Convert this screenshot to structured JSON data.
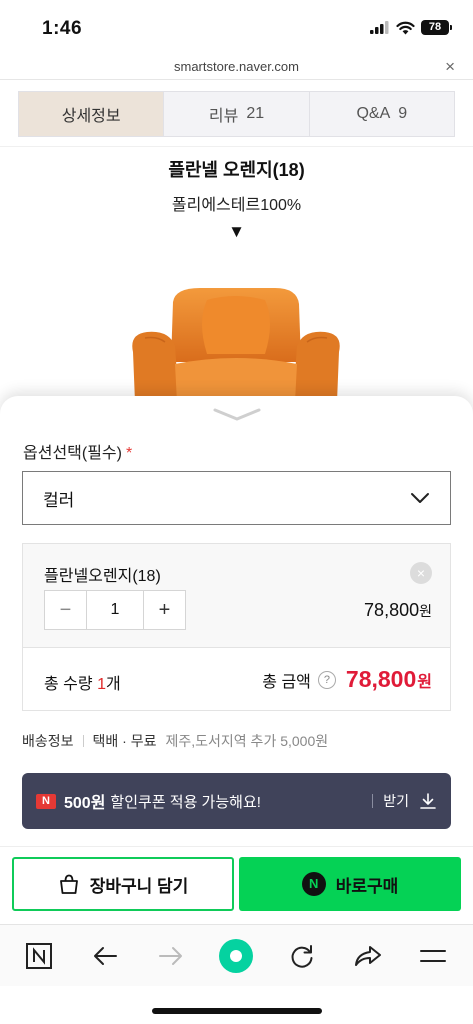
{
  "status_bar": {
    "time": "1:46",
    "battery": "78"
  },
  "url_bar": {
    "url": "smartstore.naver.com",
    "close": "×"
  },
  "tabs": [
    {
      "label": "상세정보",
      "count": ""
    },
    {
      "label": "리뷰",
      "count": "21"
    },
    {
      "label": "Q&A",
      "count": "9"
    }
  ],
  "detail": {
    "title": "플란넬 오렌지(18)",
    "subtitle": "폴리에스테르100%",
    "arrow": "▼"
  },
  "option": {
    "label": "옵션선택(필수)",
    "required_mark": "*",
    "select_value": "컬러"
  },
  "selected_item": {
    "name": "플란넬오렌지(18)",
    "remove": "×",
    "minus": "−",
    "quantity": "1",
    "plus": "+",
    "price": "78,800",
    "price_unit": "원"
  },
  "total": {
    "qty_prefix": "총 수량 ",
    "qty": "1",
    "qty_suffix": "개",
    "amount_label": "총 금액",
    "help": "?",
    "amount": "78,800",
    "amount_unit": "원"
  },
  "shipping": {
    "label": "배송정보",
    "method": "택배 · 무료",
    "extra": "제주,도서지역 추가 5,000원"
  },
  "coupon": {
    "badge": "N",
    "amount": "500원",
    "message": "할인쿠폰 적용 가능해요!",
    "get_label": "받기"
  },
  "actions": {
    "cart_label": "장바구니 담기",
    "buy_badge": "N",
    "buy_label": "바로구매"
  },
  "colors": {
    "accent_green": "#05d255",
    "price_red": "#e01b38",
    "coupon_bg": "#40435a",
    "active_tab_bg": "#ece3d9"
  }
}
